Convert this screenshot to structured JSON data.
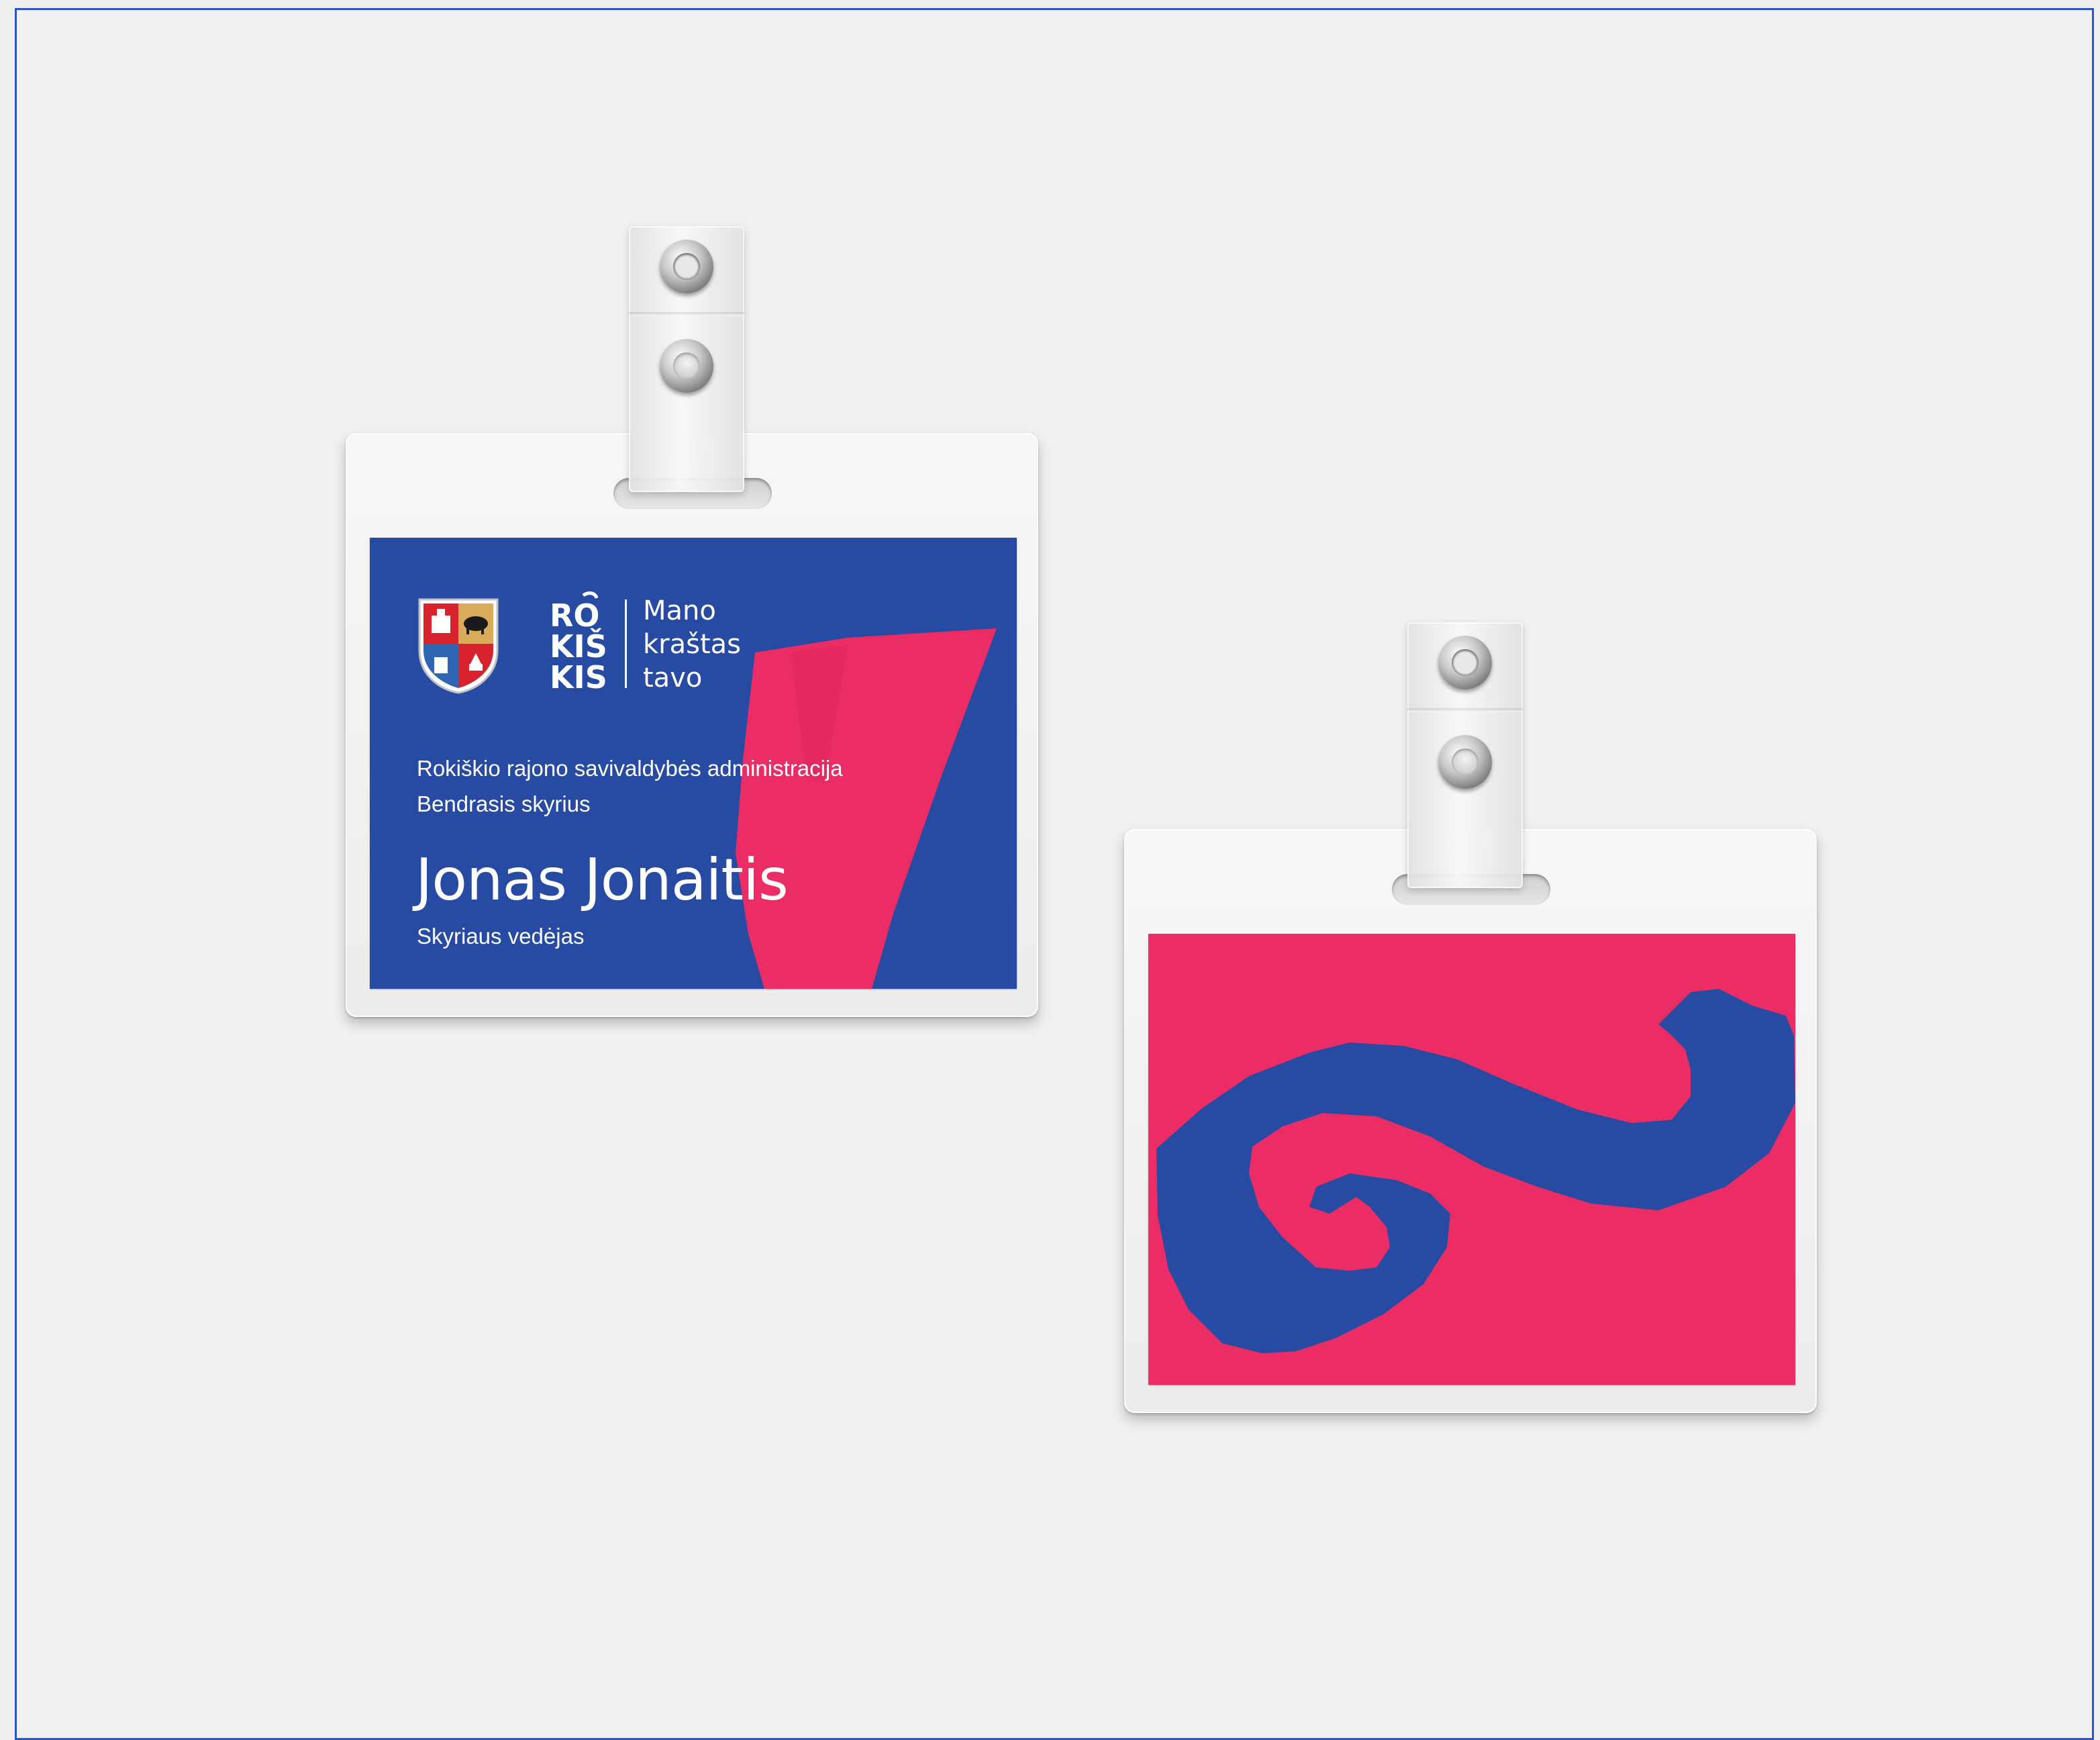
{
  "front": {
    "brand": {
      "wordmark": "ROKIŠKIS",
      "tagline_1": "Mano",
      "tagline_2": "kraštas",
      "tagline_3": "tavo"
    },
    "organization": "Rokiškio rajono savivaldybės administracija",
    "department": "Bendrasis skyrius",
    "name": "Jonas Jonaitis",
    "position": "Skyriaus vedėjas"
  },
  "colors": {
    "blue": "#274ba3",
    "pink": "#ec2c65",
    "white": "#ffffff"
  },
  "icons": [
    "coat-of-arms-icon",
    "rokiskis-logo-icon",
    "clip-rivet-icon"
  ]
}
